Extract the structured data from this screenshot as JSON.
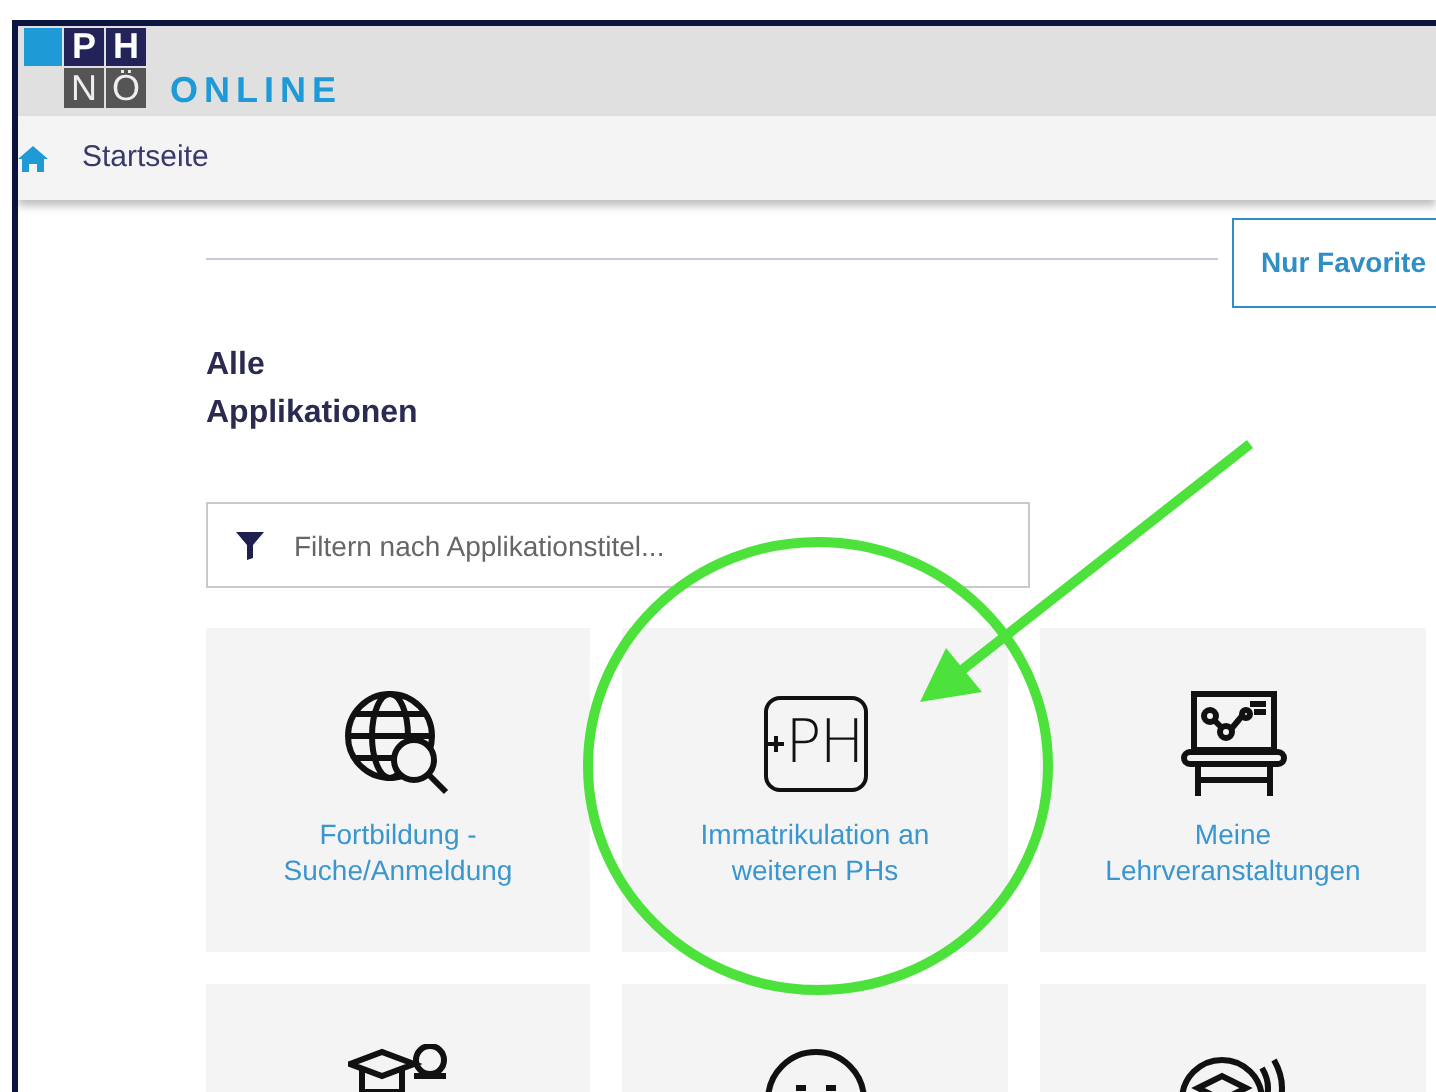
{
  "logo": {
    "top": [
      "P",
      "H"
    ],
    "bottom": [
      "N",
      "Ö"
    ],
    "word": "ONLINE"
  },
  "nav": {
    "items": [
      {
        "label": "Startseite",
        "kind": "home"
      }
    ]
  },
  "favorites_button": "Nur Favorite",
  "heading": "Alle Applikationen",
  "filter": {
    "placeholder": "Filtern nach Applikationstitel..."
  },
  "tiles": [
    {
      "kind": "globe",
      "label": "Fortbildung - Suche/Anmeldung",
      "highlighted": false
    },
    {
      "kind": "ph",
      "icon_text": "PH",
      "label": "Immatrikulation an weiteren PHs",
      "highlighted": true
    },
    {
      "kind": "lecture",
      "label": "Meine Lehrveranstaltungen",
      "highlighted": false
    },
    {
      "kind": "graduation",
      "highlighted": false
    },
    {
      "kind": "face",
      "highlighted": false
    },
    {
      "kind": "waves",
      "highlighted": false
    }
  ]
}
